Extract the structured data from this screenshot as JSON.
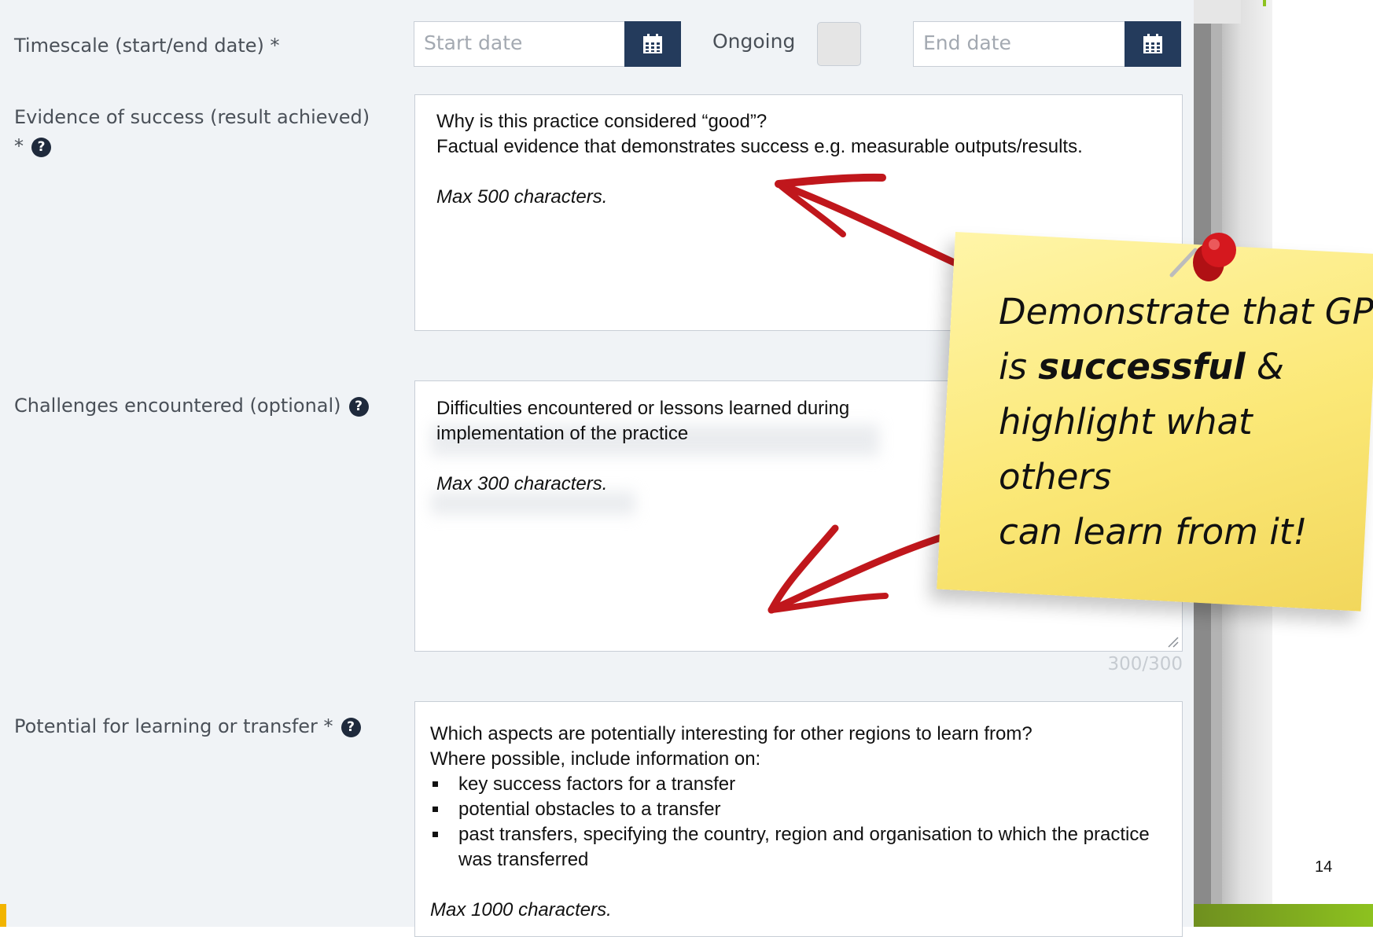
{
  "form": {
    "timescale": {
      "label": "Timescale (start/end date) *",
      "start_placeholder": "Start date",
      "ongoing_label": "Ongoing",
      "end_placeholder": "End date"
    },
    "evidence": {
      "label_line1": "Evidence of success (result achieved)",
      "label_line2": "*",
      "help": "?",
      "line1": "Why is this practice considered “good”?",
      "line2": "Factual evidence that demonstrates success e.g. measurable outputs/results.",
      "max": "Max 500 characters."
    },
    "challenges": {
      "label": "Challenges encountered (optional)",
      "help": "?",
      "line1": "Difficulties encountered or lessons learned during",
      "line2": "implementation of the practice",
      "max": "Max 300 characters.",
      "counter": "300/300"
    },
    "potential": {
      "label": "Potential for learning or transfer *",
      "help": "?",
      "line1": "Which aspects are potentially interesting for other regions to learn from?",
      "line2": "Where possible, include information on:",
      "bullets": [
        "key success factors for a transfer",
        "potential obstacles to a transfer",
        "past transfers, specifying the country, region and organisation to which the practice was transferred"
      ],
      "max": "Max 1000 characters."
    }
  },
  "note": {
    "line1": "Demonstrate that GP",
    "line2_pre": "is",
    "line2_bold": "successful",
    "line2_post": "&",
    "line3": "highlight what others",
    "line4": "can learn from it!"
  },
  "slide": {
    "page_number": "14"
  },
  "colors": {
    "panel_bg": "#f0f3f6",
    "calendar_button": "#243b5c",
    "arrow_red": "#c0171c",
    "note_yellow": "#fbe877",
    "footer_green": "#8dc21f"
  }
}
